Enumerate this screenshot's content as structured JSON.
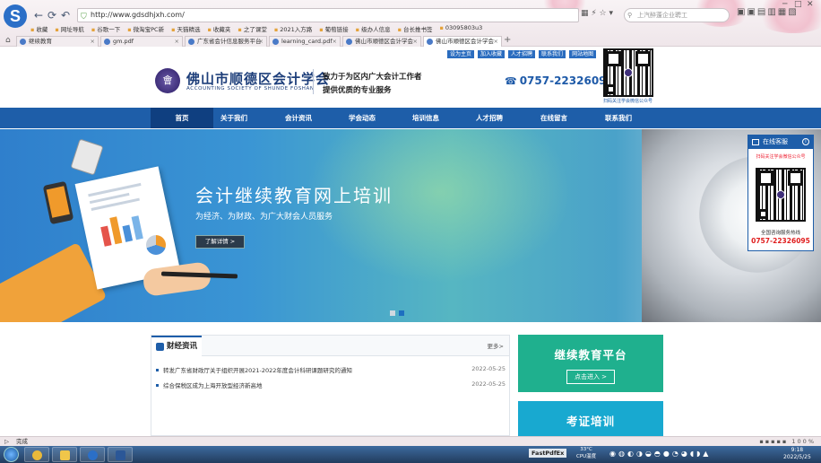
{
  "browser": {
    "url": "http://www.gdsdhjxh.com/",
    "search_placeholder": "上汽醉蓬企业聘工",
    "favorites": [
      "收藏",
      "网址导航",
      "谷歌一下",
      "微淘宝PC新",
      "天猫精选",
      "收藏夹",
      "之了课堂",
      "2021入方路",
      "葡萄链接",
      "级办人信息",
      "台长推书签",
      "03095803u3"
    ],
    "tabs": [
      {
        "label": "继续教育",
        "active": false
      },
      {
        "label": "gm.pdf",
        "active": false
      },
      {
        "label": "广东省会计信息服务平台",
        "active": false
      },
      {
        "label": "learning_card.pdf",
        "active": false
      },
      {
        "label": "佛山市顺德区会计学会",
        "active": false
      },
      {
        "label": "佛山市顺德区会计学会",
        "active": true
      }
    ],
    "status_text": "完成",
    "zoom": "100%"
  },
  "site": {
    "top_links": [
      "设为主页",
      "加入收藏",
      "人才招聘",
      "联系我们",
      "网站地图"
    ],
    "brand_cn": "佛山市顺德区会计学会",
    "brand_en": "ACCOUNTING SOCIETY OF SHUNDE FOSHAN",
    "slogan_line1": "致力于为区内广大会计工作者",
    "slogan_line2": "提供优质的专业服务",
    "phone": "0757-22326095",
    "qr_caption": "扫码关注学会微信公众号",
    "nav": [
      "首页",
      "关于我们",
      "会计资讯",
      "学会动态",
      "培训信息",
      "人才招聘",
      "在线留言",
      "联系我们"
    ],
    "banner": {
      "title": "会计继续教育网上培训",
      "subtitle": "为经济、为财政、为广大财会人员服务",
      "button": "了解详情 >"
    },
    "service": {
      "title": "在线客服",
      "qr_caption": "扫码关注学会微信公众号",
      "hotline_label": "全国咨询服务热线",
      "hotline": "0757-22326095"
    },
    "news": {
      "tab": "财经资讯",
      "more": "更多>",
      "items": [
        {
          "title": "转发广东省财政厅关于组织开展2021-2022年度会计科研课题研究的通知",
          "date": "2022-05-25"
        },
        {
          "title": "综合保税区成为上海开放型经济新高地",
          "date": "2022-05-25"
        }
      ]
    },
    "promo": [
      {
        "title": "继续教育平台",
        "button": "点击进入 >"
      },
      {
        "title": "考证培训",
        "button": ""
      }
    ]
  },
  "taskbar": {
    "fastpdf": "FastPdfEx",
    "temp": "33°C",
    "cpu_label": "CPU温度",
    "time": "9:18",
    "date": "2022/5/25"
  }
}
